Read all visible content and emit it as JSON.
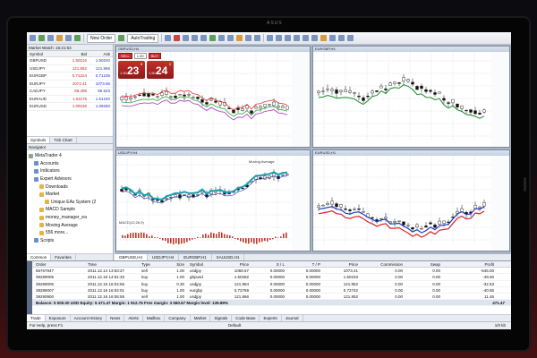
{
  "tablet": {
    "label": "ASUS"
  },
  "toolbar": {
    "new_order": "New Order",
    "auto_trading": "AutoTrading"
  },
  "market_watch": {
    "title": "Market Watch: 16:21:53",
    "headers": {
      "symbol": "Symbol",
      "bid": "Bid",
      "ask": "Ask"
    },
    "rows": [
      {
        "symbol": "GBPUSD",
        "bid": "1.50216",
        "ask": "1.50240"
      },
      {
        "symbol": "USDJPY",
        "bid": "121.852",
        "ask": "121.866"
      },
      {
        "symbol": "EURGBP",
        "bid": "0.71224",
        "ask": "0.71236"
      },
      {
        "symbol": "EURJPY",
        "bid": "1073.41",
        "ask": "1073.65"
      },
      {
        "symbol": "CADJPY",
        "bid": "86.498",
        "ask": "86.523"
      },
      {
        "symbol": "EURAUD",
        "bid": "1.51176",
        "ask": "1.51240"
      },
      {
        "symbol": "EURUSD",
        "bid": "1.09236",
        "ask": "1.09250"
      }
    ],
    "tabs": [
      "Symbols",
      "Tick Chart"
    ]
  },
  "navigator": {
    "title": "Navigator",
    "items": [
      {
        "label": "MetaTrader 4",
        "indent": 0,
        "icon": "terminal-icon"
      },
      {
        "label": "Accounts",
        "indent": 1,
        "icon": "accounts-icon"
      },
      {
        "label": "Indicators",
        "indent": 1,
        "icon": "indicators-icon"
      },
      {
        "label": "Expert Advisors",
        "indent": 1,
        "icon": "experts-icon"
      },
      {
        "label": "Downloads",
        "indent": 2,
        "icon": "folder-icon"
      },
      {
        "label": "Market",
        "indent": 2,
        "icon": "folder-icon"
      },
      {
        "label": "Unique EAs System (2",
        "indent": 3,
        "icon": "ea-icon"
      },
      {
        "label": "MACD Sample",
        "indent": 2,
        "icon": "ea-icon"
      },
      {
        "label": "money_manager_ea",
        "indent": 2,
        "icon": "ea-icon"
      },
      {
        "label": "Moving Average",
        "indent": 2,
        "icon": "ea-icon"
      },
      {
        "label": "556 more...",
        "indent": 2,
        "icon": "more-icon"
      },
      {
        "label": "Scripts",
        "indent": 1,
        "icon": "scripts-icon"
      }
    ],
    "tabs": [
      "Common",
      "Favorites"
    ]
  },
  "charts": {
    "windows": [
      {
        "title": "GBPUSD,H4",
        "trade": {
          "sell": "SELL",
          "buy": "BUY",
          "lot": "1.00",
          "sell_big": "23",
          "sell_pre": "1.50",
          "sell_sup": "8",
          "buy_big": "24",
          "buy_pre": "1.50",
          "buy_sup": "0"
        }
      },
      {
        "title": "EURGBP,H4"
      },
      {
        "title": "USDJPY,H4",
        "indicator": "MACD(12,26,9)",
        "ma_label": "Moving Average"
      },
      {
        "title": "EURUSD,H1"
      }
    ],
    "tabs": [
      "GBPUSD,H4",
      "USDJPY,H4",
      "EURGBP,H1",
      "XAUUSD,H1"
    ]
  },
  "terminal": {
    "headers": {
      "order": "Order",
      "time": "Time",
      "type": "Type",
      "size": "Size",
      "symbol": "Symbol",
      "price": "Price",
      "sl": "S / L",
      "tp": "T / P",
      "pr": "Price",
      "commission": "Commission",
      "swap": "Swap",
      "profit": "Profit"
    },
    "rows": [
      {
        "order": "55767947",
        "time": "2011.12.14 13:53:27",
        "type": "sell",
        "size": "1.00",
        "symbol": "usdjpy",
        "price": "1068.57",
        "sl": "0.00000",
        "tp": "0.00000",
        "pr": "1073.41",
        "commission": "0.00",
        "swap": "0.00",
        "profit": "-545.00"
      },
      {
        "order": "39289005",
        "time": "2011.12.16 14:51:33",
        "type": "buy",
        "size": "1.00",
        "symbol": "gbpusd",
        "price": "1.50282",
        "sl": "0.00000",
        "tp": "0.00000",
        "pr": "1.50233",
        "commission": "0.00",
        "swap": "0.00",
        "profit": "-49.00"
      },
      {
        "order": "39289006",
        "time": "2011.12.16 16:04:55",
        "type": "buy",
        "size": "0.30",
        "symbol": "usdjpy",
        "price": "121.984",
        "sl": "0.00000",
        "tp": "0.00000",
        "pr": "121.852",
        "commission": "0.00",
        "swap": "0.00",
        "profit": "-32.53"
      },
      {
        "order": "39289007",
        "time": "2011.12.16 16:04:01",
        "type": "buy",
        "size": "1.00",
        "symbol": "eurgbp",
        "price": "0.72769",
        "sl": "0.00000",
        "tp": "0.00000",
        "pr": "0.72742",
        "commission": "0.00",
        "swap": "0.00",
        "profit": "-40.56"
      },
      {
        "order": "39290900",
        "time": "2011.12.16 16:05:55",
        "type": "sell",
        "size": "1.00",
        "symbol": "usdjpy",
        "price": "121.866",
        "sl": "0.00000",
        "tp": "0.00000",
        "pr": "121.852",
        "commission": "0.00",
        "swap": "0.00",
        "profit": "11.46"
      }
    ],
    "balance": {
      "text": "Balance: 5 000.00 USD  Equity: 5 471.47  Margin: 1 912.75  Free margin: 3 560.67  Margin level: 139.89%",
      "profit": "471.47"
    },
    "tabs": [
      "Trade",
      "Exposure",
      "Account History",
      "News",
      "Alerts",
      "Mailbox",
      "Company",
      "Market",
      "Signals",
      "Code Base",
      "Experts",
      "Journal"
    ]
  },
  "status": {
    "help": "For Help, press F1",
    "profile": "Default",
    "connection": "1/0 kb"
  }
}
